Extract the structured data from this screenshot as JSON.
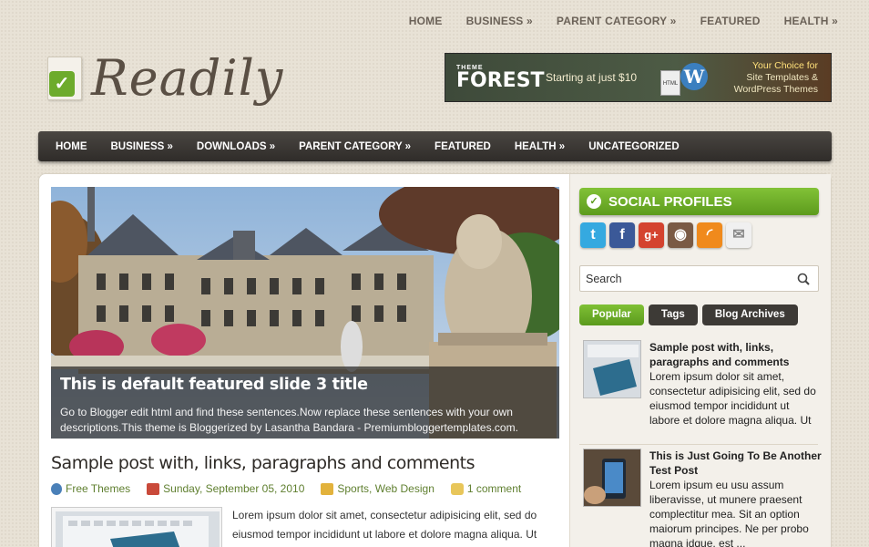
{
  "top_nav": [
    "HOME",
    "BUSINESS »",
    "PARENT CATEGORY »",
    "FEATURED",
    "HEALTH »"
  ],
  "logo": {
    "text": "Readily",
    "icon": "checkmark-document-icon"
  },
  "banner": {
    "brand_top": "THEME",
    "brand_bottom": "FOREST",
    "price_text": "Starting at just $10",
    "html_label": "HTML",
    "right_line1": "Your Choice for",
    "right_line2": "Site Templates &",
    "right_line3": "WordPress Themes"
  },
  "main_nav": [
    "HOME",
    "BUSINESS »",
    "DOWNLOADS »",
    "PARENT CATEGORY »",
    "FEATURED",
    "HEALTH »",
    "UNCATEGORIZED"
  ],
  "slide": {
    "title": "This is default featured slide 3 title",
    "description": "Go to Blogger edit html and find these sentences.Now replace these sentences with your own descriptions.This theme is Bloggerized by Lasantha Bandara - Premiumbloggertemplates.com."
  },
  "post": {
    "title": "Sample post with, links, paragraphs and comments",
    "author": "Free Themes",
    "date": "Sunday, September 05, 2010",
    "categories": "Sports, Web Design",
    "comments": "1 comment",
    "excerpt": "Lorem ipsum dolor sit amet, consectetur adipisicing elit, sed do eiusmod tempor incididunt ut labore et dolore magna aliqua. Ut"
  },
  "sidebar": {
    "social_title": "SOCIAL PROFILES",
    "social_icons": [
      {
        "name": "twitter-icon",
        "glyph": "t",
        "color": "#35a9e0"
      },
      {
        "name": "facebook-icon",
        "glyph": "f",
        "color": "#3b5998"
      },
      {
        "name": "google-plus-icon",
        "glyph": "g+",
        "color": "#d4432f"
      },
      {
        "name": "instagram-icon",
        "glyph": "◉",
        "color": "#7a5a44"
      },
      {
        "name": "rss-icon",
        "glyph": "◜",
        "color": "#f08a1c"
      },
      {
        "name": "email-icon",
        "glyph": "✉",
        "color": "#e8e8e8"
      }
    ],
    "search_placeholder": "Search",
    "tabs": [
      "Popular",
      "Tags",
      "Blog Archives"
    ],
    "popular": [
      {
        "title": "Sample post with, links, paragraphs and comments",
        "text": "Lorem ipsum dolor sit amet, consectetur adipisicing elit, sed do eiusmod tempor incididunt ut labore et dolore magna aliqua. Ut enim ad m..."
      },
      {
        "title": "This is Just Going To Be Another Test Post",
        "text": "Lorem ipsum eu usu assum liberavisse, ut munere praesent complectitur mea. Sit an option maiorum principes. Ne per probo magna idque, est ..."
      }
    ]
  }
}
